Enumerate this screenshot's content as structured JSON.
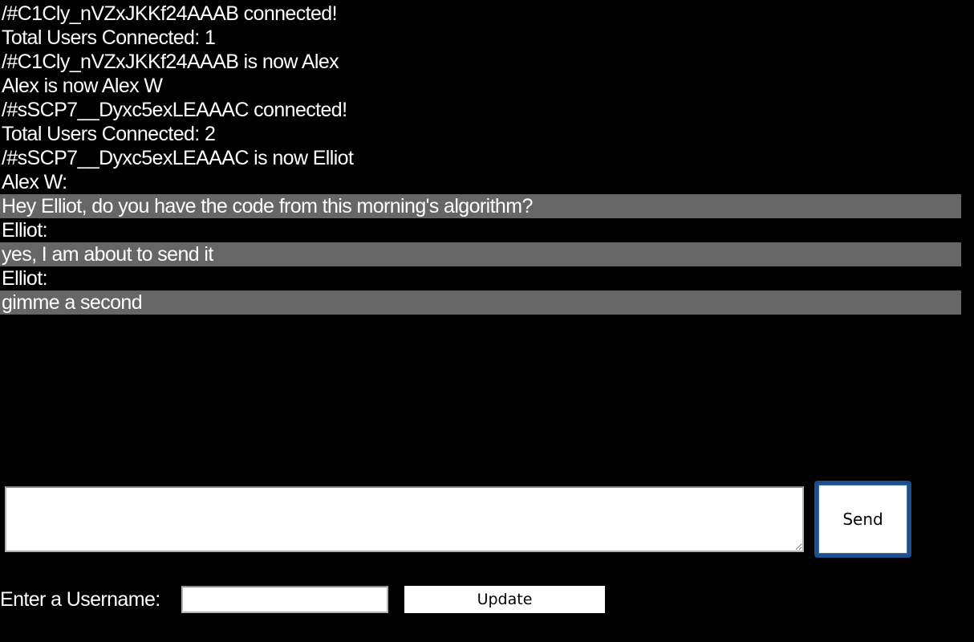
{
  "chat": {
    "lines": [
      {
        "text": "/#C1Cly_nVZxJKKf24AAAB connected!",
        "kind": "system"
      },
      {
        "text": "Total Users Connected: 1",
        "kind": "system"
      },
      {
        "text": "/#C1Cly_nVZxJKKf24AAAB is now Alex",
        "kind": "system"
      },
      {
        "text": "Alex is now Alex W",
        "kind": "system"
      },
      {
        "text": "/#sSCP7__Dyxc5exLEAAAC connected!",
        "kind": "system"
      },
      {
        "text": "Total Users Connected: 2",
        "kind": "system"
      },
      {
        "text": "/#sSCP7__Dyxc5exLEAAAC is now Elliot",
        "kind": "system"
      },
      {
        "text": "Alex W:",
        "kind": "sender"
      },
      {
        "text": "Hey Elliot, do you have the code from this morning's algorithm?",
        "kind": "message"
      },
      {
        "text": "Elliot:",
        "kind": "sender"
      },
      {
        "text": "yes, I am about to send it",
        "kind": "message"
      },
      {
        "text": "Elliot:",
        "kind": "sender"
      },
      {
        "text": "gimme a second",
        "kind": "message"
      }
    ]
  },
  "composer": {
    "message_value": "",
    "send_label": "Send"
  },
  "username_form": {
    "label": "Enter a Username:",
    "value": "",
    "update_label": "Update"
  },
  "colors": {
    "background": "#000000",
    "text": "#ffffff",
    "message_bubble": "#666666",
    "send_button_border": "#1e4f8c"
  }
}
